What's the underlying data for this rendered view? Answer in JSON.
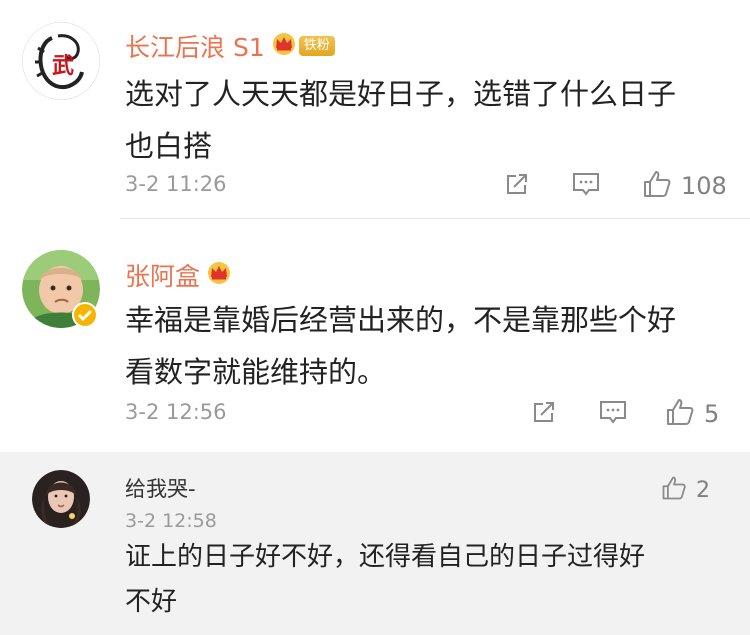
{
  "comments": [
    {
      "username": "长江后浪 S1",
      "badge": "铁粉",
      "text_lines": [
        "选对了人天天都是好日子，选错了什么日子",
        "也白搭"
      ],
      "time": "3-2 11:26",
      "likes": "108",
      "avatar_glyph": "武"
    },
    {
      "username": "张阿盒",
      "text_lines": [
        "幸福是靠婚后经营出来的，不是靠那些个好",
        "看数字就能维持的。"
      ],
      "time": "3-2 12:56",
      "likes": "5",
      "verified": true
    }
  ],
  "reply": {
    "username": "给我哭-",
    "time": "3-2 12:58",
    "likes": "2",
    "text_lines": [
      "证上的日子好不好，还得看自己的日子过得好",
      "不好"
    ]
  },
  "icons": {
    "repost": "repost-icon",
    "comment": "comment-icon",
    "like": "thumbs-up-icon",
    "crown": "crown-icon",
    "verified": "verified-badge-icon"
  },
  "colors": {
    "username": "#eb7350",
    "text": "#222222",
    "meta": "#9a9a9a",
    "reply_bg": "#f2f2f2",
    "badge": "#e2a624"
  }
}
